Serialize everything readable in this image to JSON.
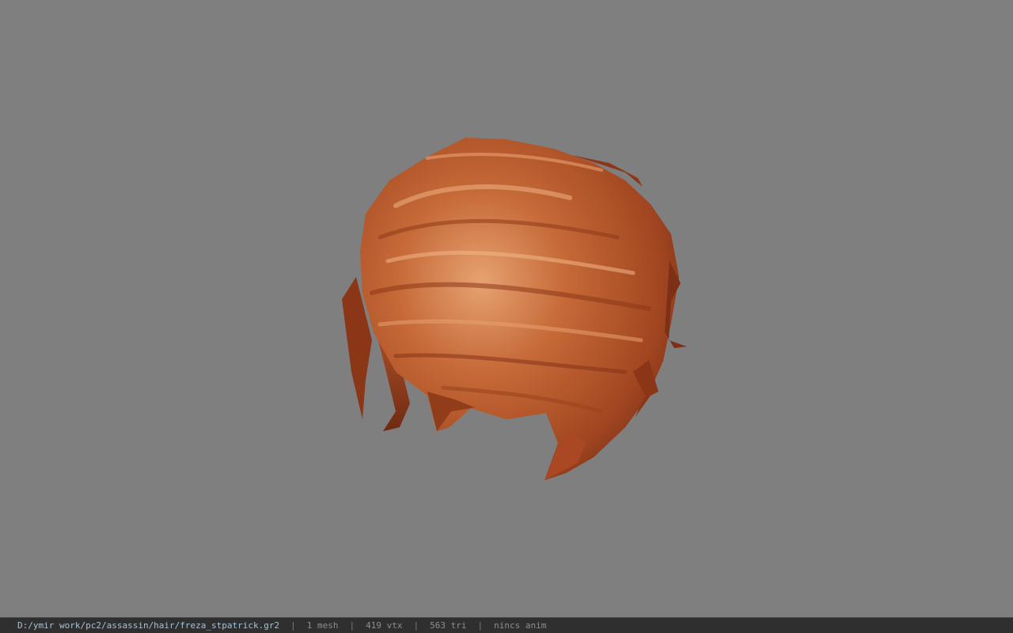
{
  "viewport": {
    "background": "#7f7f7f",
    "model_name": "freza_stpatrick",
    "hair_colors": {
      "base": "#b5532a",
      "shadow": "#7a2e14",
      "highlight": "#e39a6a"
    }
  },
  "statusbar": {
    "path": "D:/ymir work/pc2/assassin/hair/freza_stpatrick.gr2",
    "separator": "|",
    "mesh": "1 mesh",
    "vtx": "419 vtx",
    "tri": "563 tri",
    "anim": "nincs anim"
  }
}
